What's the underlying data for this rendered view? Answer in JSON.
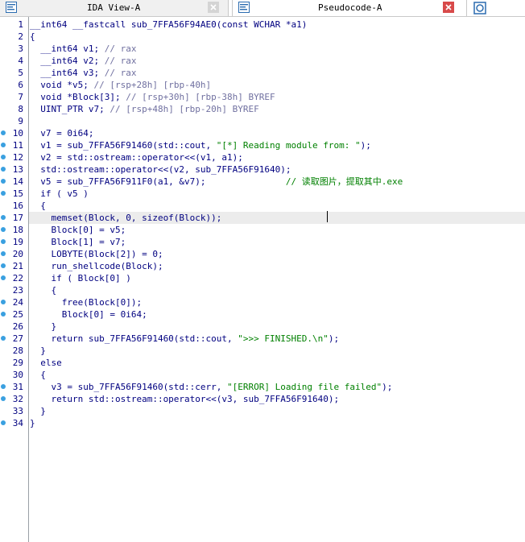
{
  "tabs": [
    {
      "title": "IDA View-A",
      "active": false
    },
    {
      "title": "Pseudocode-A",
      "active": true
    }
  ],
  "colors": {
    "keyword": "#000080",
    "variable": "#6060c0",
    "comment": "#7070a0",
    "string": "#008000",
    "breakpoint_dot": "#3aa0e0",
    "highlight_line": "#ececec"
  },
  "code_lines": [
    {
      "n": "1",
      "dot": false,
      "text": "__int64 __fastcall sub_7FFA56F94AE0(const WCHAR *a1)"
    },
    {
      "n": "2",
      "dot": false,
      "text": "{"
    },
    {
      "n": "3",
      "dot": false,
      "text": "  __int64 v1; // rax"
    },
    {
      "n": "4",
      "dot": false,
      "text": "  __int64 v2; // rax"
    },
    {
      "n": "5",
      "dot": false,
      "text": "  __int64 v3; // rax"
    },
    {
      "n": "6",
      "dot": false,
      "text": "  void *v5; // [rsp+28h] [rbp-40h]"
    },
    {
      "n": "7",
      "dot": false,
      "text": "  void *Block[3]; // [rsp+30h] [rbp-38h] BYREF"
    },
    {
      "n": "8",
      "dot": false,
      "text": "  UINT_PTR v7; // [rsp+48h] [rbp-20h] BYREF"
    },
    {
      "n": "9",
      "dot": false,
      "text": ""
    },
    {
      "n": "10",
      "dot": true,
      "text": "  v7 = 0i64;"
    },
    {
      "n": "11",
      "dot": true,
      "text": "  v1 = sub_7FFA56F91460(std::cout, \"[*] Reading module from: \");"
    },
    {
      "n": "12",
      "dot": true,
      "text": "  v2 = std::ostream::operator<<(v1, a1);"
    },
    {
      "n": "13",
      "dot": true,
      "text": "  std::ostream::operator<<(v2, sub_7FFA56F91640);"
    },
    {
      "n": "14",
      "dot": true,
      "text": "  v5 = sub_7FFA56F911F0(a1, &v7);               // 读取图片，提取其中.exe"
    },
    {
      "n": "15",
      "dot": true,
      "text": "  if ( v5 )"
    },
    {
      "n": "16",
      "dot": false,
      "text": "  {"
    },
    {
      "n": "17",
      "dot": true,
      "text": "    memset(Block, 0, sizeof(Block));"
    },
    {
      "n": "18",
      "dot": true,
      "text": "    Block[0] = v5;"
    },
    {
      "n": "19",
      "dot": true,
      "text": "    Block[1] = v7;"
    },
    {
      "n": "20",
      "dot": true,
      "text": "    LOBYTE(Block[2]) = 0;"
    },
    {
      "n": "21",
      "dot": true,
      "text": "    run_shellcode(Block);"
    },
    {
      "n": "22",
      "dot": true,
      "text": "    if ( Block[0] )"
    },
    {
      "n": "23",
      "dot": false,
      "text": "    {"
    },
    {
      "n": "24",
      "dot": true,
      "text": "      free(Block[0]);"
    },
    {
      "n": "25",
      "dot": true,
      "text": "      Block[0] = 0i64;"
    },
    {
      "n": "26",
      "dot": false,
      "text": "    }"
    },
    {
      "n": "27",
      "dot": true,
      "text": "    return sub_7FFA56F91460(std::cout, \">>> FINISHED.\\n\");"
    },
    {
      "n": "28",
      "dot": false,
      "text": "  }"
    },
    {
      "n": "29",
      "dot": false,
      "text": "  else"
    },
    {
      "n": "30",
      "dot": false,
      "text": "  {"
    },
    {
      "n": "31",
      "dot": true,
      "text": "    v3 = sub_7FFA56F91460(std::cerr, \"[ERROR] Loading file failed\");"
    },
    {
      "n": "32",
      "dot": true,
      "text": "    return std::ostream::operator<<(v3, sub_7FFA56F91640);"
    },
    {
      "n": "33",
      "dot": false,
      "text": "  }"
    },
    {
      "n": "34",
      "dot": true,
      "text": "}"
    }
  ],
  "highlighted_line": "17"
}
